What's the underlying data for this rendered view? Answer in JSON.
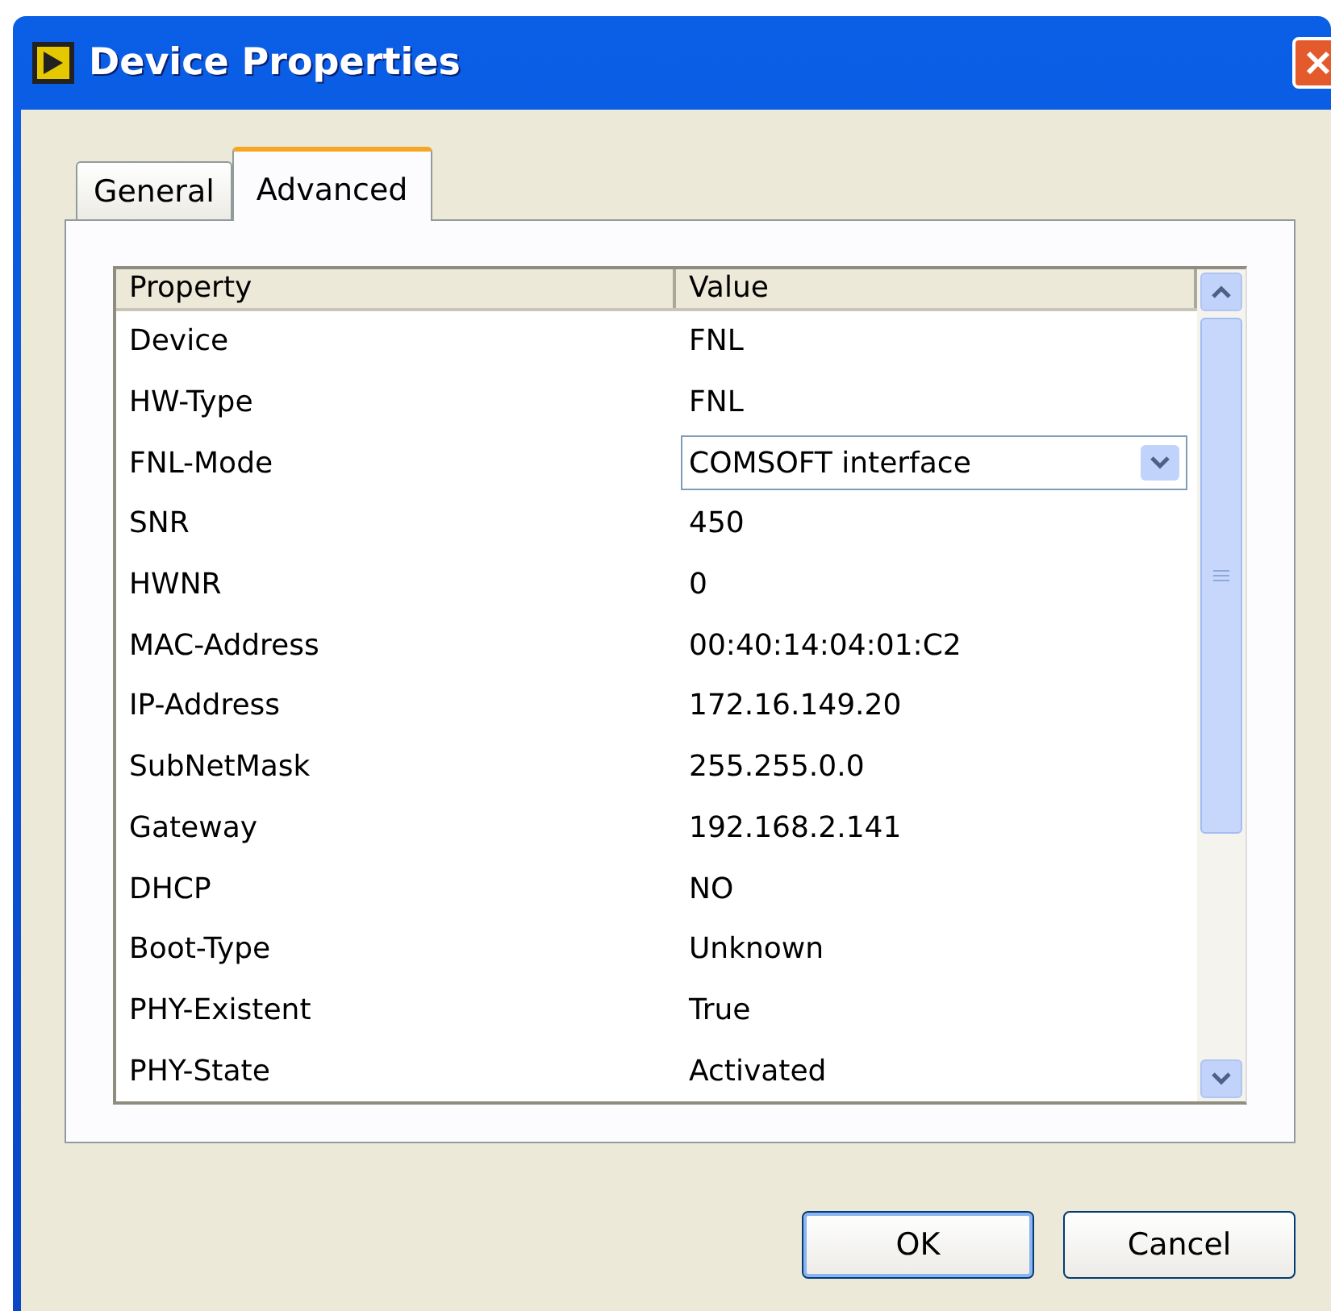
{
  "window": {
    "title": "Device Properties"
  },
  "tabs": [
    {
      "label": "General",
      "selected": false
    },
    {
      "label": "Advanced",
      "selected": true
    }
  ],
  "table": {
    "columns": [
      "Property",
      "Value"
    ],
    "rows": [
      {
        "property": "Device",
        "value": "FNL",
        "kind": "text"
      },
      {
        "property": "HW-Type",
        "value": "FNL",
        "kind": "text"
      },
      {
        "property": "FNL-Mode",
        "value": "COMSOFT interface",
        "kind": "dropdown"
      },
      {
        "property": "SNR",
        "value": "450",
        "kind": "text"
      },
      {
        "property": "HWNR",
        "value": "0",
        "kind": "text"
      },
      {
        "property": "MAC-Address",
        "value": "00:40:14:04:01:C2",
        "kind": "text"
      },
      {
        "property": "IP-Address",
        "value": "172.16.149.20",
        "kind": "text"
      },
      {
        "property": "SubNetMask",
        "value": "255.255.0.0",
        "kind": "text"
      },
      {
        "property": "Gateway",
        "value": "192.168.2.141",
        "kind": "text"
      },
      {
        "property": "DHCP",
        "value": "NO",
        "kind": "text"
      },
      {
        "property": "Boot-Type",
        "value": "Unknown",
        "kind": "text"
      },
      {
        "property": "PHY-Existent",
        "value": "True",
        "kind": "text"
      },
      {
        "property": "PHY-State",
        "value": "Activated",
        "kind": "text"
      }
    ]
  },
  "buttons": [
    "OK",
    "Cancel"
  ]
}
